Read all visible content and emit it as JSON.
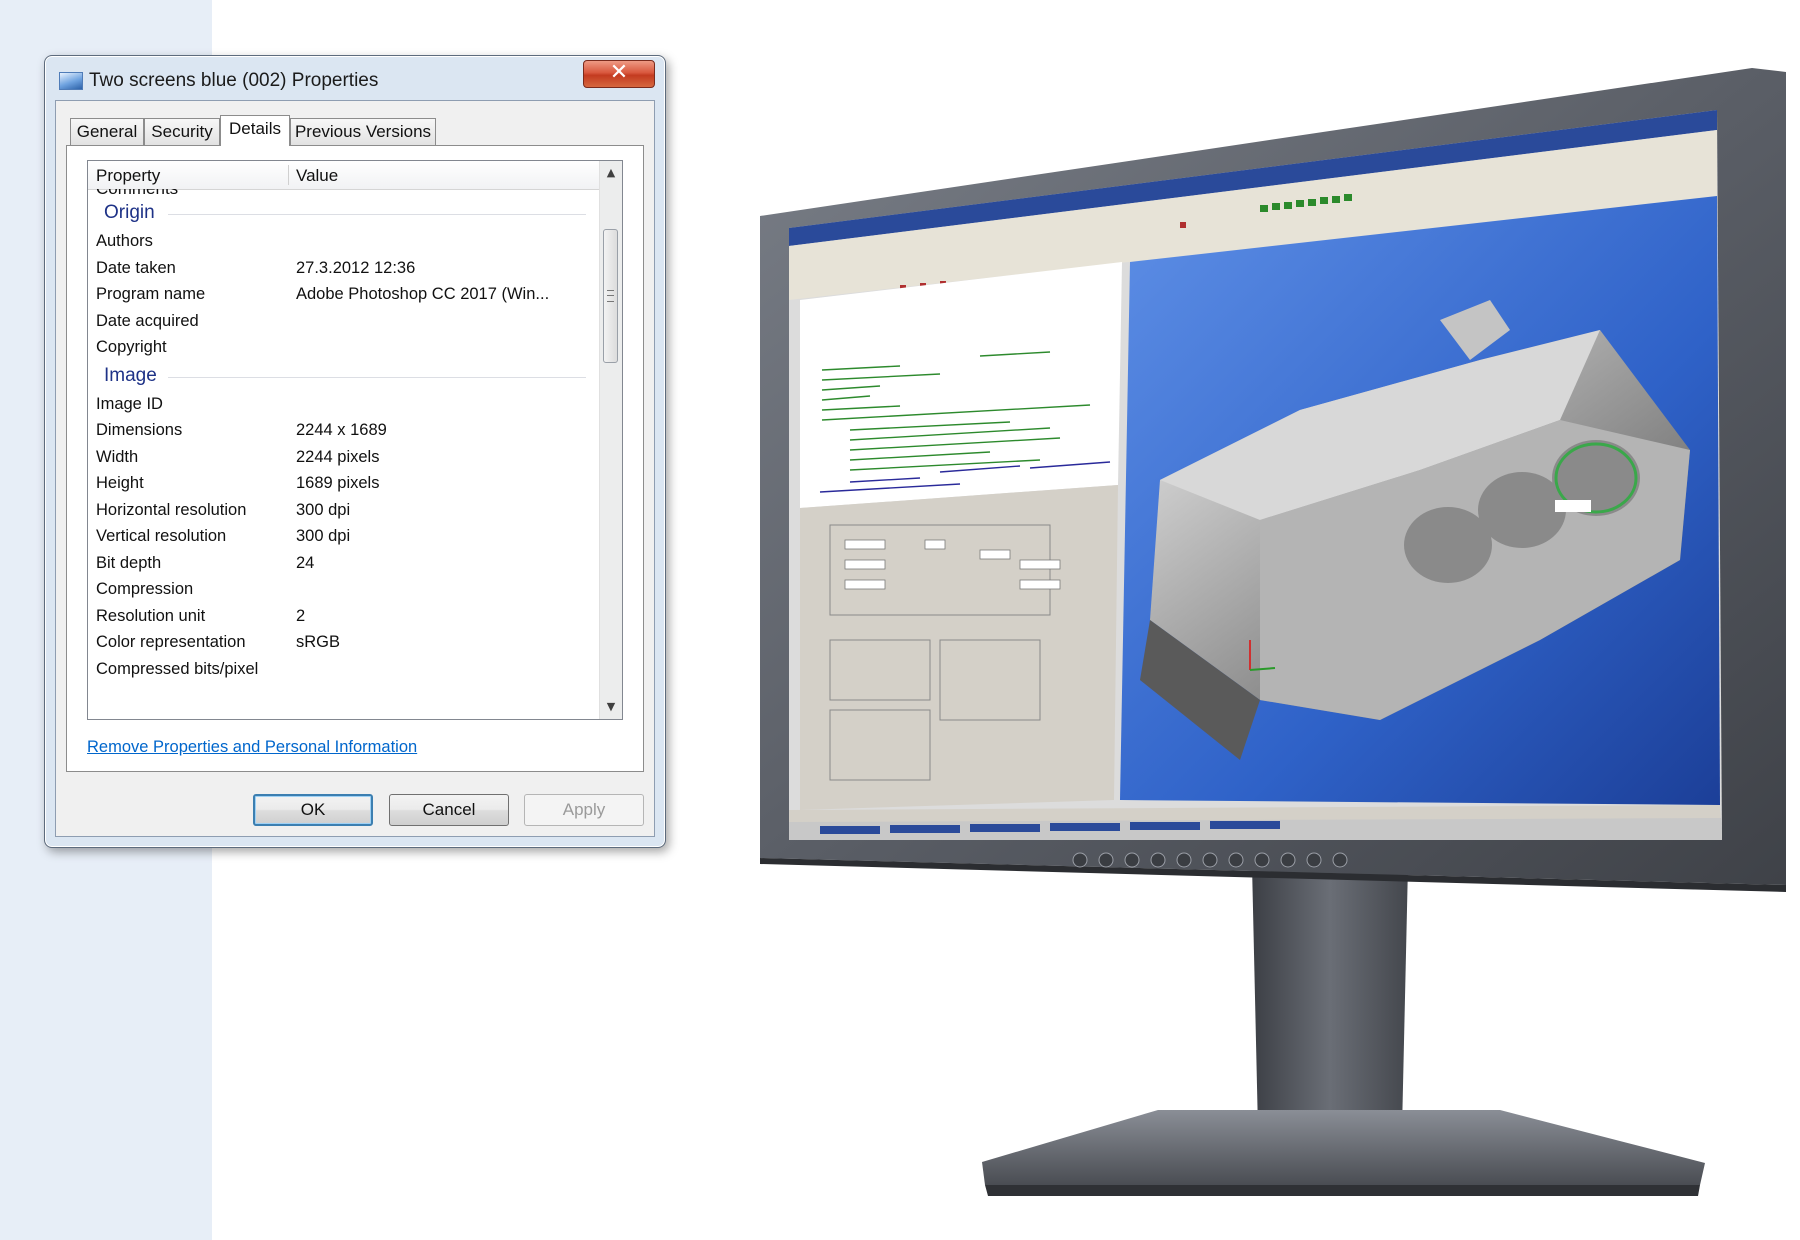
{
  "dialog": {
    "title": "Two screens blue (002) Properties",
    "close_glyph": "✕",
    "tabs": [
      {
        "label": "General"
      },
      {
        "label": "Security"
      },
      {
        "label": "Details"
      },
      {
        "label": "Previous Versions"
      }
    ],
    "active_tab": "Details",
    "list": {
      "header_property": "Property",
      "header_value": "Value",
      "cut_off_row": "Comments",
      "groups": [
        {
          "label": "Origin",
          "rows": [
            {
              "property": "Authors",
              "value": ""
            },
            {
              "property": "Date taken",
              "value": "27.3.2012 12:36"
            },
            {
              "property": "Program name",
              "value": "Adobe Photoshop CC 2017 (Win..."
            },
            {
              "property": "Date acquired",
              "value": ""
            },
            {
              "property": "Copyright",
              "value": ""
            }
          ]
        },
        {
          "label": "Image",
          "rows": [
            {
              "property": "Image ID",
              "value": ""
            },
            {
              "property": "Dimensions",
              "value": "2244 x 1689"
            },
            {
              "property": "Width",
              "value": "2244 pixels"
            },
            {
              "property": "Height",
              "value": "1689 pixels"
            },
            {
              "property": "Horizontal resolution",
              "value": "300 dpi"
            },
            {
              "property": "Vertical resolution",
              "value": "300 dpi"
            },
            {
              "property": "Bit depth",
              "value": "24"
            },
            {
              "property": "Compression",
              "value": ""
            },
            {
              "property": "Resolution unit",
              "value": "2"
            },
            {
              "property": "Color representation",
              "value": "sRGB"
            },
            {
              "property": "Compressed bits/pixel",
              "value": ""
            }
          ]
        }
      ]
    },
    "remove_link": "Remove Properties and Personal Information",
    "buttons": {
      "ok": "OK",
      "cancel": "Cancel",
      "apply": "Apply"
    }
  },
  "colors": {
    "dialog_frame": "#dbe6f2",
    "group_header": "#1e3287",
    "link": "#0066cc",
    "close_button": "#c9442a",
    "monitor_bezel": "#5a5e66",
    "cad_viewport_blue": "#2f62c8",
    "cad_code_green": "#2d8a2d"
  },
  "icons": {
    "title": "image-file-icon",
    "close": "close-icon",
    "scroll_up": "scroll-up-arrow-icon",
    "scroll_down": "scroll-down-arrow-icon"
  }
}
